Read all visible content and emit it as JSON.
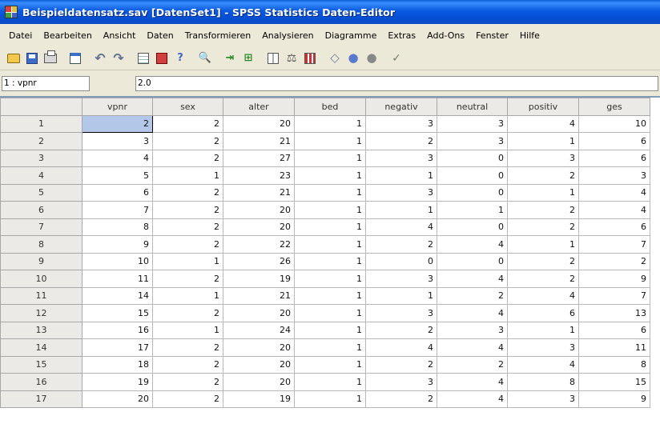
{
  "window": {
    "title": "Beispieldatensatz.sav [DatenSet1] - SPSS Statistics Daten-Editor"
  },
  "menu": [
    {
      "label": "Datei"
    },
    {
      "label": "Bearbeiten"
    },
    {
      "label": "Ansicht"
    },
    {
      "label": "Daten"
    },
    {
      "label": "Transformieren"
    },
    {
      "label": "Analysieren"
    },
    {
      "label": "Diagramme"
    },
    {
      "label": "Extras"
    },
    {
      "label": "Add-Ons"
    },
    {
      "label": "Fenster"
    },
    {
      "label": "Hilfe"
    }
  ],
  "toolbar_icons": [
    "open-icon",
    "save-icon",
    "print-icon",
    "dialog-recall-icon",
    "undo-icon",
    "redo-icon",
    "goto-case-icon",
    "variables-icon",
    "help-icon",
    "find-icon",
    "insert-case-icon",
    "insert-variable-icon",
    "split-file-icon",
    "weight-cases-icon",
    "select-cases-icon",
    "value-labels-icon",
    "use-sets-icon",
    "show-all-icon",
    "spell-check-icon"
  ],
  "cell_editor": {
    "reference": "1 : vpnr",
    "value": "2.0"
  },
  "grid": {
    "columns": [
      "vpnr",
      "sex",
      "alter",
      "bed",
      "negativ",
      "neutral",
      "positiv",
      "ges"
    ],
    "rows": [
      {
        "n": "1",
        "cells": [
          "2",
          "2",
          "20",
          "1",
          "3",
          "3",
          "4",
          "10"
        ]
      },
      {
        "n": "2",
        "cells": [
          "3",
          "2",
          "21",
          "1",
          "2",
          "3",
          "1",
          "6"
        ]
      },
      {
        "n": "3",
        "cells": [
          "4",
          "2",
          "27",
          "1",
          "3",
          "0",
          "3",
          "6"
        ]
      },
      {
        "n": "4",
        "cells": [
          "5",
          "1",
          "23",
          "1",
          "1",
          "0",
          "2",
          "3"
        ]
      },
      {
        "n": "5",
        "cells": [
          "6",
          "2",
          "21",
          "1",
          "3",
          "0",
          "1",
          "4"
        ]
      },
      {
        "n": "6",
        "cells": [
          "7",
          "2",
          "20",
          "1",
          "1",
          "1",
          "2",
          "4"
        ]
      },
      {
        "n": "7",
        "cells": [
          "8",
          "2",
          "20",
          "1",
          "4",
          "0",
          "2",
          "6"
        ]
      },
      {
        "n": "8",
        "cells": [
          "9",
          "2",
          "22",
          "1",
          "2",
          "4",
          "1",
          "7"
        ]
      },
      {
        "n": "9",
        "cells": [
          "10",
          "1",
          "26",
          "1",
          "0",
          "0",
          "2",
          "2"
        ]
      },
      {
        "n": "10",
        "cells": [
          "11",
          "2",
          "19",
          "1",
          "3",
          "4",
          "2",
          "9"
        ]
      },
      {
        "n": "11",
        "cells": [
          "14",
          "1",
          "21",
          "1",
          "1",
          "2",
          "4",
          "7"
        ]
      },
      {
        "n": "12",
        "cells": [
          "15",
          "2",
          "20",
          "1",
          "3",
          "4",
          "6",
          "13"
        ]
      },
      {
        "n": "13",
        "cells": [
          "16",
          "1",
          "24",
          "1",
          "2",
          "3",
          "1",
          "6"
        ]
      },
      {
        "n": "14",
        "cells": [
          "17",
          "2",
          "20",
          "1",
          "4",
          "4",
          "3",
          "11"
        ]
      },
      {
        "n": "15",
        "cells": [
          "18",
          "2",
          "20",
          "1",
          "2",
          "2",
          "4",
          "8"
        ]
      },
      {
        "n": "16",
        "cells": [
          "19",
          "2",
          "20",
          "1",
          "3",
          "4",
          "8",
          "15"
        ]
      },
      {
        "n": "17",
        "cells": [
          "20",
          "2",
          "19",
          "1",
          "2",
          "4",
          "3",
          "9"
        ]
      }
    ]
  }
}
